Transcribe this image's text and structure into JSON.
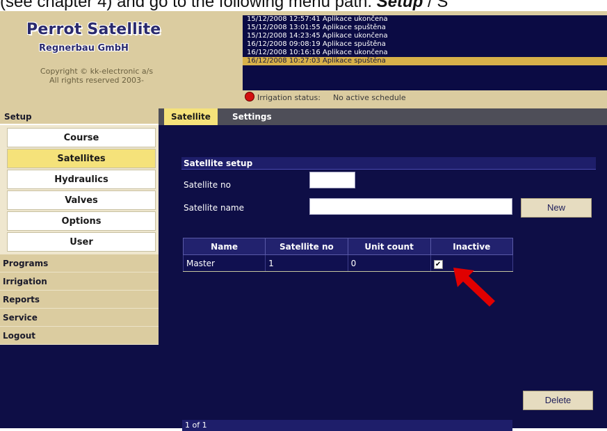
{
  "doc": {
    "line_before": "(see chapter 4) and go to the following menu path: ",
    "line_bold": "Setup",
    "line_after": " / S"
  },
  "header": {
    "logo_line1": "Perrot Satellite",
    "logo_line2": "Regnerbau GmbH",
    "copyright_line1": "Copyright © kk-electronic a/s",
    "copyright_line2": "All rights reserved 2003-"
  },
  "log": [
    "15/12/2008 12:57:41 Aplikace ukončena",
    "15/12/2008 13:01:55 Aplikace spuštěna",
    "15/12/2008 14:23:45 Aplikace ukončena",
    "16/12/2008 09:08:19 Aplikace spuštěna",
    "16/12/2008 10:16:16 Aplikace ukončena",
    "16/12/2008 10:27:03 Aplikace spuštěna"
  ],
  "status": {
    "label": "Irrigation status:",
    "value": "No active schedule",
    "indicator_color": "#d21010"
  },
  "sidebar": {
    "setup_label": "Setup",
    "sub_items": [
      "Course",
      "Satellites",
      "Hydraulics",
      "Valves",
      "Options",
      "User"
    ],
    "active_sub": "Satellites",
    "sections": [
      "Programs",
      "Irrigation",
      "Reports",
      "Service",
      "Logout"
    ]
  },
  "tabs": {
    "active": "Satellite",
    "other": "Settings"
  },
  "form": {
    "section_title": "Satellite setup",
    "satellite_no_label": "Satellite no",
    "satellite_no_value": "",
    "satellite_name_label": "Satellite name",
    "satellite_name_value": "",
    "new_button": "New"
  },
  "table": {
    "columns": [
      "Name",
      "Satellite no",
      "Unit count",
      "Inactive"
    ],
    "rows": [
      {
        "name": "Master",
        "satellite_no": "1",
        "unit_count": "0",
        "inactive": true,
        "check_glyph": "✔"
      }
    ]
  },
  "pager": {
    "text": "1 of 1"
  },
  "delete_button": "Delete",
  "colors": {
    "accent": "#f5e27a",
    "panel": "#0e0e46",
    "header": "#dbcca0",
    "annotation_arrow": "#e00000"
  }
}
